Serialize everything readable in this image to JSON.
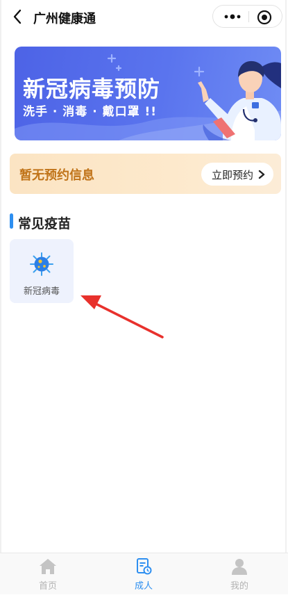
{
  "header": {
    "title": "广州健康通",
    "back_icon": "chevron-left-icon",
    "more_icon": "more-dots-icon",
    "target_icon": "target-icon"
  },
  "banner": {
    "title": "新冠病毒预防",
    "subtitle": "洗手 · 消毒 · 戴口罩 !!",
    "image": "doctor-illustration"
  },
  "appointment": {
    "status_text": "暂无预约信息",
    "button_label": "立即预约",
    "button_icon": "chevron-right-icon"
  },
  "vaccines": {
    "section_title": "常见疫苗",
    "items": [
      {
        "label": "新冠病毒",
        "icon": "virus-icon"
      }
    ]
  },
  "tabbar": {
    "tabs": [
      {
        "label": "首页",
        "icon": "home-icon",
        "active": false
      },
      {
        "label": "成人",
        "icon": "document-clock-icon",
        "active": true
      },
      {
        "label": "我的",
        "icon": "user-icon",
        "active": false
      }
    ]
  },
  "colors": {
    "accent": "#2e8ff0",
    "banner": "#5a74ee",
    "appointment_text": "#c07318",
    "annotation_arrow": "#e8312c"
  }
}
